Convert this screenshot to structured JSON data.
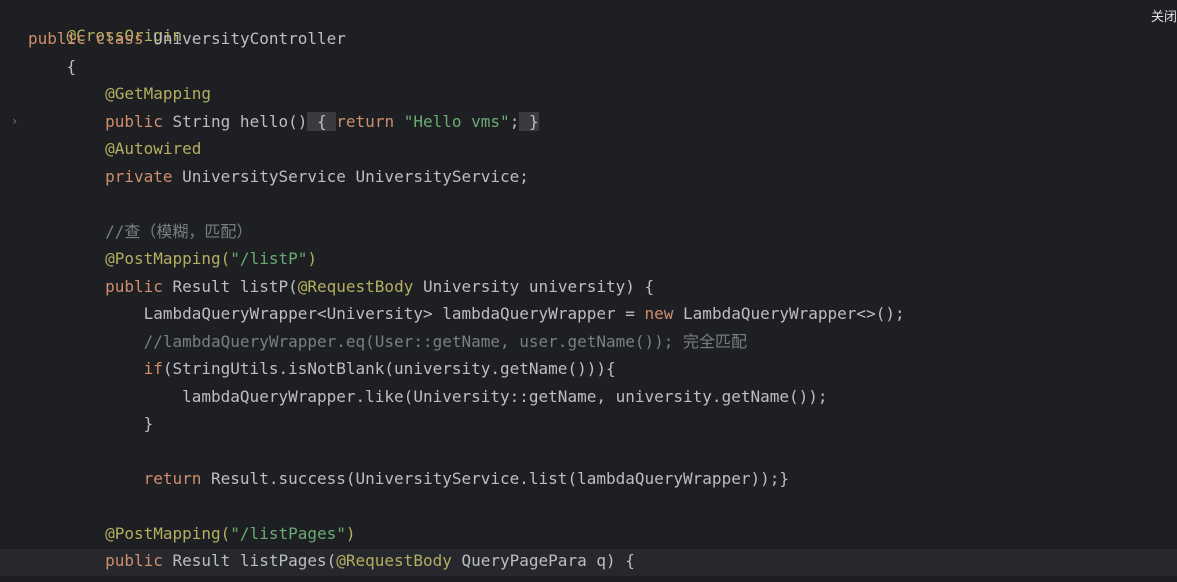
{
  "close_label": "关闭",
  "fold_icon": "chevron-right-icon",
  "lines": {
    "l1": {
      "ann": "@CrossOrigin"
    },
    "l2": {
      "kw1": "public",
      "kw2": "class",
      "name": "UniversityController"
    },
    "l3": {
      "text": "{"
    },
    "l4": {
      "ann": "@GetMapping"
    },
    "l5": {
      "kw1": "public",
      "t1": "String hello()",
      "b1": "{",
      "kw2": "return",
      "str": "\"Hello vms\"",
      "t2": ";",
      "b2": "}"
    },
    "l6": {
      "ann": "@Autowired"
    },
    "l7": {
      "kw1": "private",
      "t1": "UniversityService UniversityService;"
    },
    "l9": {
      "cmt": "//查（模糊，匹配）"
    },
    "l10": {
      "ann": "@PostMapping(",
      "str": "\"/listP\"",
      "t1": ")"
    },
    "l11": {
      "kw1": "public",
      "t1": "Result listP(",
      "ann": "@RequestBody",
      "t2": " University university) {"
    },
    "l12": {
      "t1": "LambdaQueryWrapper<University> lambdaQueryWrapper = ",
      "kw1": "new",
      "t2": " LambdaQueryWrapper<>();"
    },
    "l13": {
      "cmt": "//lambdaQueryWrapper.eq(User::getName, user.getName()); 完全匹配"
    },
    "l14": {
      "kw1": "if",
      "t1": "(StringUtils.isNotBlank(university.getName())){"
    },
    "l15": {
      "t1": "lambdaQueryWrapper.like(University::getName, university.getName());"
    },
    "l16": {
      "t1": "}"
    },
    "l18": {
      "kw1": "return",
      "t1": " Result.success(UniversityService.list(lambdaQueryWrapper));}"
    },
    "l20": {
      "ann": "@PostMapping(",
      "str": "\"/listPages\"",
      "t1": ")"
    },
    "l21": {
      "kw1": "public",
      "t1": " Result listPages(",
      "ann": "@RequestBody",
      "t2": " QueryPagePara q) {"
    }
  }
}
